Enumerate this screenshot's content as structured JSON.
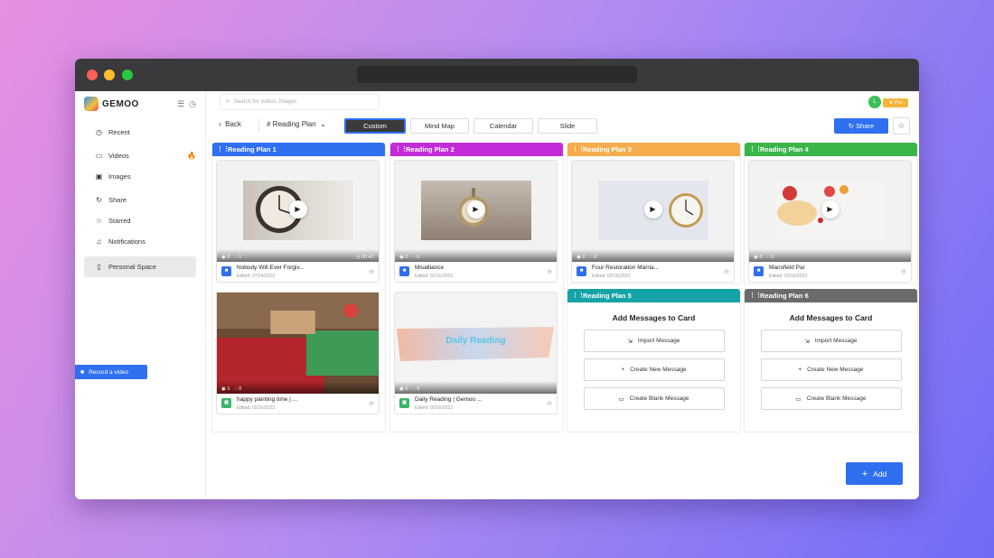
{
  "app": {
    "logo_text": "GEMOO"
  },
  "sidebar": {
    "items": [
      {
        "label": "Recent",
        "icon": "clock-icon"
      },
      {
        "label": "Videos",
        "icon": "video-icon"
      },
      {
        "label": "Images",
        "icon": "image-icon"
      },
      {
        "label": "Share",
        "icon": "share-icon"
      },
      {
        "label": "Starred",
        "icon": "star-icon"
      },
      {
        "label": "Notifications",
        "icon": "bell-icon"
      },
      {
        "label": "Personal Space",
        "icon": "file-icon"
      }
    ],
    "record_label": "Record a video"
  },
  "header": {
    "search_placeholder": "Search for videos, images",
    "avatar_letter": "L",
    "pro_label": "Pro"
  },
  "toolbar": {
    "back_label": "Back",
    "plan_label": "# Reading Plan",
    "views": [
      "Custom",
      "Mind Map",
      "Calendar",
      "Slide"
    ],
    "share_label": "Share"
  },
  "columns": [
    {
      "title": "Reading Plan 1",
      "color": "#2f6ff0"
    },
    {
      "title": "Reading Plan 2",
      "color": "#c32bd9"
    },
    {
      "title": "Reading Plan 3",
      "color": "#f5ad4c"
    },
    {
      "title": "Reading Plan 4",
      "color": "#3ab54a"
    },
    {
      "title": "Reading Plan 5",
      "color": "#16a3a8"
    },
    {
      "title": "Reading Plan 6",
      "color": "#6b6b6b"
    }
  ],
  "cards": [
    {
      "title": "Nobody Will Ever Forgiv...",
      "edited": "Edited: 07/24/2023",
      "views": "0",
      "comments": "1",
      "duration": "00:47"
    },
    {
      "title": "Misalliance",
      "edited": "Edited: 02/16/2023",
      "views": "0",
      "comments": "0"
    },
    {
      "title": "Four Restoration Marria...",
      "edited": "Edited: 02/16/2023",
      "views": "0",
      "comments": "0"
    },
    {
      "title": "Mansfield Par",
      "edited": "Edited: 02/16/2023",
      "views": "0",
      "comments": "0"
    },
    {
      "title": "happy painting time | ...",
      "edited": "Edited: 02/16/2023",
      "views": "1",
      "comments": "0"
    },
    {
      "title": "Daily Reading | Gemoo ...",
      "edited": "Edited: 02/16/2023",
      "views": "0",
      "comments": "0",
      "banner_text": "Daily Reading"
    }
  ],
  "message_panel": {
    "title": "Add Messages to Card",
    "import": "Import Message",
    "create_new": "Create New Message",
    "create_blank": "Create Blank Message"
  },
  "add_label": "Add"
}
